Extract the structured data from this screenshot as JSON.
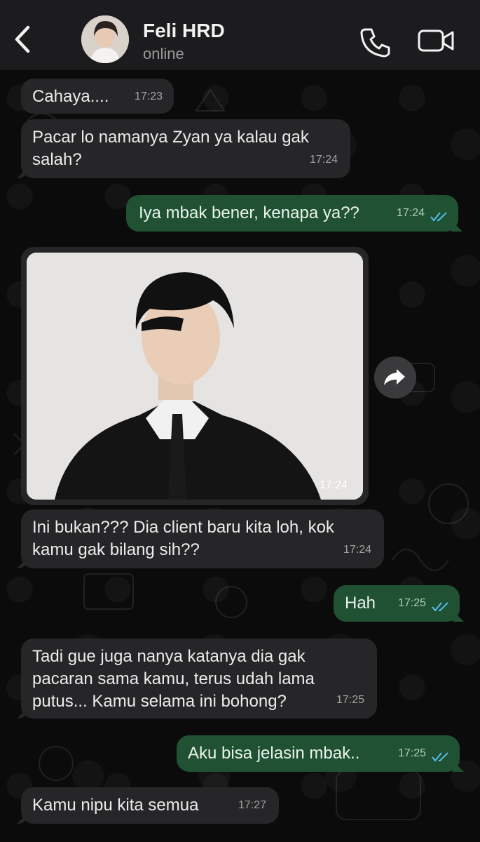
{
  "header": {
    "contact_name": "Feli HRD",
    "status": "online",
    "icons": [
      "back-chevron-icon",
      "contact-avatar",
      "phone-icon",
      "video-icon"
    ]
  },
  "messages": [
    {
      "dir": "in",
      "text": "Cahaya....",
      "time": "17:23"
    },
    {
      "dir": "in",
      "text": "Pacar lo namanya Zyan ya kalau gak salah?",
      "time": "17:24"
    },
    {
      "dir": "out",
      "text": "Iya mbak bener, kenapa ya??",
      "time": "17:24",
      "read": true
    },
    {
      "dir": "in",
      "type": "image",
      "time": "17:24"
    },
    {
      "dir": "in",
      "text": "Ini bukan??? Dia client baru kita loh, kok kamu gak bilang sih??",
      "time": "17:24"
    },
    {
      "dir": "out",
      "text": "Hah",
      "time": "17:25",
      "read": true
    },
    {
      "dir": "in",
      "text": "Tadi gue juga nanya katanya dia gak pacaran sama kamu, terus udah lama putus... Kamu selama ini bohong?",
      "time": "17:25"
    },
    {
      "dir": "out",
      "text": "Aku bisa jelasin mbak..",
      "time": "17:25",
      "read": true
    },
    {
      "dir": "in",
      "text": "Kamu nipu kita semua",
      "time": "17:27"
    }
  ],
  "colors": {
    "incoming_bubble": "#262628",
    "outgoing_bubble": "#1f5132",
    "read_ticks": "#53bdeb",
    "header_bg": "#1c1c1e"
  }
}
